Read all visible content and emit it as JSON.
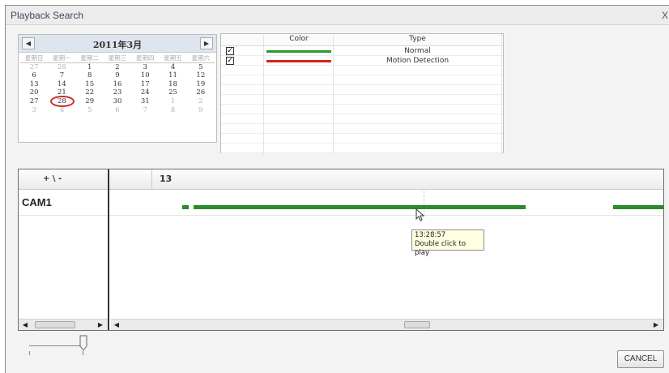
{
  "window": {
    "title": "Playback Search",
    "close": "X"
  },
  "calendar": {
    "title": "2011年3月",
    "prev": "◀",
    "next": "▶",
    "weekdays": [
      "星期日",
      "星期一",
      "星期二",
      "星期三",
      "星期四",
      "星期五",
      "星期六"
    ],
    "weeks": [
      [
        {
          "d": "27",
          "dim": true
        },
        {
          "d": "28",
          "dim": true
        },
        {
          "d": "1"
        },
        {
          "d": "2"
        },
        {
          "d": "3"
        },
        {
          "d": "4"
        },
        {
          "d": "5"
        }
      ],
      [
        {
          "d": "6"
        },
        {
          "d": "7"
        },
        {
          "d": "8"
        },
        {
          "d": "9"
        },
        {
          "d": "10"
        },
        {
          "d": "11"
        },
        {
          "d": "12"
        }
      ],
      [
        {
          "d": "13"
        },
        {
          "d": "14"
        },
        {
          "d": "15"
        },
        {
          "d": "16"
        },
        {
          "d": "17"
        },
        {
          "d": "18"
        },
        {
          "d": "19"
        }
      ],
      [
        {
          "d": "20"
        },
        {
          "d": "21"
        },
        {
          "d": "22"
        },
        {
          "d": "23"
        },
        {
          "d": "24"
        },
        {
          "d": "25"
        },
        {
          "d": "26"
        }
      ],
      [
        {
          "d": "27"
        },
        {
          "d": "28",
          "selected": true
        },
        {
          "d": "29"
        },
        {
          "d": "30"
        },
        {
          "d": "31"
        },
        {
          "d": "1",
          "dim": true
        },
        {
          "d": "2",
          "dim": true
        }
      ],
      [
        {
          "d": "3",
          "dim": true
        },
        {
          "d": "4",
          "dim": true
        },
        {
          "d": "5",
          "dim": true
        },
        {
          "d": "6",
          "dim": true
        },
        {
          "d": "7",
          "dim": true
        },
        {
          "d": "8",
          "dim": true
        },
        {
          "d": "9",
          "dim": true
        }
      ]
    ]
  },
  "legend": {
    "header_color": "Color",
    "header_type": "Type",
    "rows": [
      {
        "checked": true,
        "color": "#2b9a2b",
        "type": "Normal"
      },
      {
        "checked": true,
        "color": "#d62020",
        "type": "Motion Detection"
      }
    ]
  },
  "timeline": {
    "zoom_label": "+ \\ -",
    "hour_label": "13",
    "camera": "CAM1",
    "record_color": "#2b8a2b",
    "tooltip_time": "13:28:57",
    "tooltip_hint": "Double click to play"
  },
  "buttons": {
    "cancel": "CANCEL"
  }
}
